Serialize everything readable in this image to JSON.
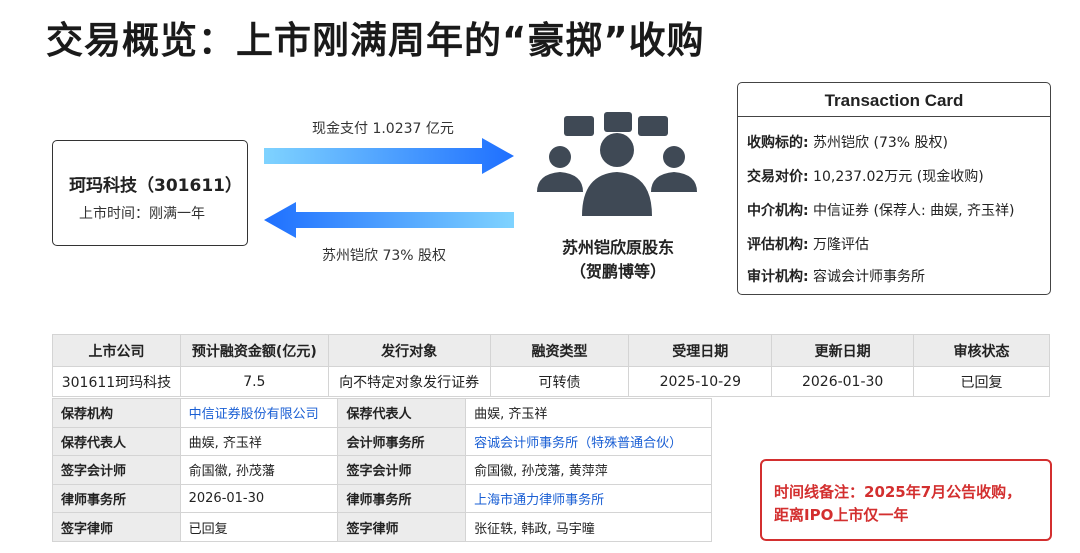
{
  "title": "交易概览：上市刚满周年的“豪掷”收购",
  "acquirer": {
    "name": "珂玛科技（301611）",
    "sub": "上市时间：刚满一年"
  },
  "flows": {
    "top": "现金支付 1.0237 亿元",
    "bottom": "苏州铠欣 73% 股权"
  },
  "holder": {
    "line1": "苏州铠欣原股东",
    "line2": "（贺鹏博等）"
  },
  "card": {
    "title": "Transaction Card",
    "rows": [
      {
        "k": "收购标的:",
        "v": " 苏州铠欣 (73% 股权)"
      },
      {
        "k": "交易对价:",
        "v": " 10,237.02万元 (现金收购)"
      },
      {
        "k": "中介机构:",
        "v": " 中信证券 (保荐人: 曲娱, 齐玉祥)"
      },
      {
        "k": "评估机构:",
        "v": " 万隆评估"
      },
      {
        "k": "审计机构:",
        "v": " 容诚会计师事务所"
      }
    ]
  },
  "main_table": {
    "headers": [
      "上市公司",
      "预计融资金额(亿元)",
      "发行对象",
      "融资类型",
      "受理日期",
      "更新日期",
      "审核状态"
    ],
    "row": [
      "301611珂玛科技",
      "7.5",
      "向不特定对象发行证券",
      "可转债",
      "2025-10-29",
      "2026-01-30",
      "已回复"
    ]
  },
  "detail_table": {
    "rows": [
      [
        "保荐机构",
        "中信证券股份有限公司",
        "保荐代表人",
        "曲娱, 齐玉祥"
      ],
      [
        "保荐代表人",
        "曲娱, 齐玉祥",
        "会计师事务所",
        "容诚会计师事务所（特殊普通合伙）"
      ],
      [
        "签字会计师",
        "俞国徽, 孙茂藩",
        "签字会计师",
        "俞国徽, 孙茂藩, 黄萍萍"
      ],
      [
        "律师事务所",
        "2026-01-30",
        "律师事务所",
        "上海市通力律师事务所"
      ],
      [
        "签字律师",
        "已回复",
        "签字律师",
        "张征轶, 韩政, 马宇曈"
      ]
    ]
  },
  "note": {
    "line1": "时间线备注：2025年7月公告收购，",
    "line2": "距离IPO上市仅一年"
  },
  "colors": {
    "link": "#1a5fd4",
    "alert": "#d32f2f",
    "arrow": "#2a8cff",
    "people": "#3f4955"
  },
  "icons": [
    "arrow-right-icon",
    "arrow-left-icon",
    "people-group-icon"
  ]
}
